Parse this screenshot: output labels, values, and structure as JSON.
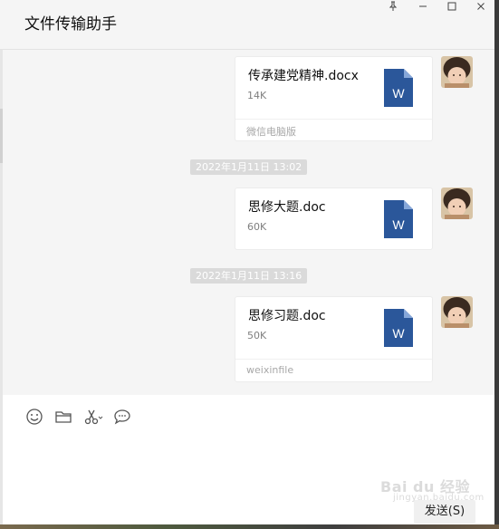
{
  "window": {
    "title": "文件传输助手",
    "controls": {
      "pin": "pin-icon",
      "minimize": "minimize-icon",
      "maximize": "maximize-icon",
      "close": "close-icon"
    }
  },
  "messages": [
    {
      "file_name": "传承建党精神.docx",
      "file_size": "14K",
      "source": "微信电脑版",
      "file_icon": "word-doc-icon",
      "file_icon_letter": "W"
    },
    {
      "timestamp": "2022年1月11日 13:02"
    },
    {
      "file_name": "思修大题.doc",
      "file_size": "60K",
      "source": "",
      "file_icon": "word-doc-icon",
      "file_icon_letter": "W"
    },
    {
      "timestamp": "2022年1月11日 13:16"
    },
    {
      "file_name": "思修习题.doc",
      "file_size": "50K",
      "source": "weixinfile",
      "file_icon": "word-doc-icon",
      "file_icon_letter": "W"
    }
  ],
  "toolbar": {
    "items": [
      "emoji-icon",
      "folder-icon",
      "scissors-icon",
      "chat-history-icon"
    ]
  },
  "send_button": {
    "label": "发送(S)"
  },
  "watermark": {
    "brand": "Bai du 经验",
    "sub": "jingyan.baidu.com"
  },
  "colors": {
    "word_blue": "#2b579a",
    "chat_bg": "#f5f5f5",
    "timestamp_bg": "#dadada"
  }
}
